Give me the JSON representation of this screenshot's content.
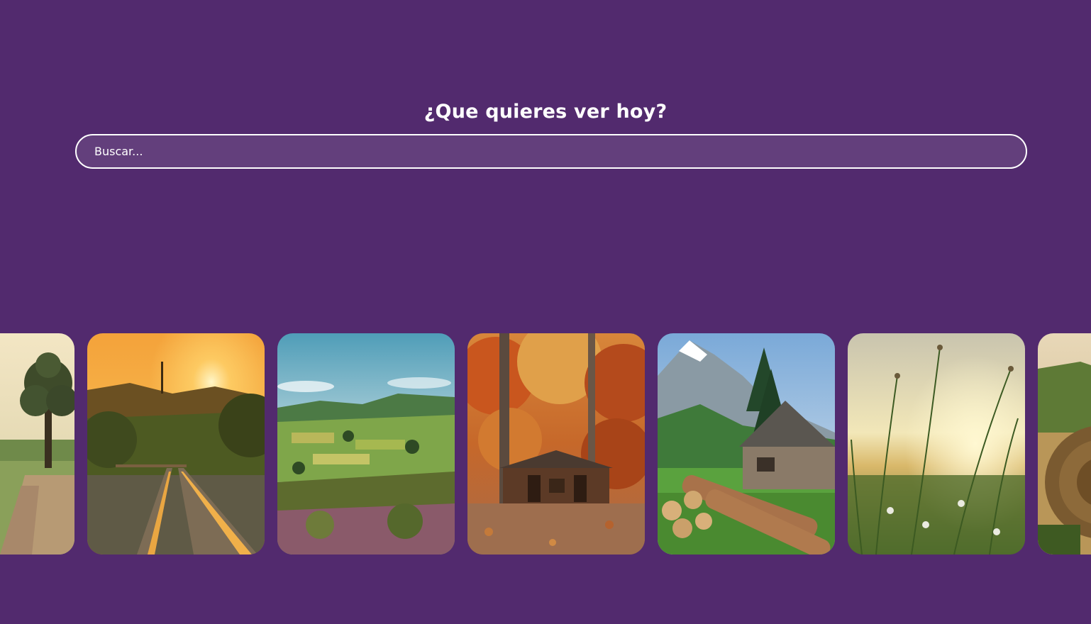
{
  "header": {
    "title": "¿Que quieres ver hoy?"
  },
  "search": {
    "placeholder": "Buscar..."
  },
  "gallery": {
    "images": [
      {
        "name": "tree-dirt-road-image"
      },
      {
        "name": "railway-sunset-image"
      },
      {
        "name": "green-valley-image"
      },
      {
        "name": "autumn-cabin-image"
      },
      {
        "name": "mountain-barn-logs-image"
      },
      {
        "name": "meadow-grass-sunset-image"
      },
      {
        "name": "hay-bale-image"
      }
    ]
  },
  "colors": {
    "background": "#522a6e",
    "text": "#ffffff"
  }
}
